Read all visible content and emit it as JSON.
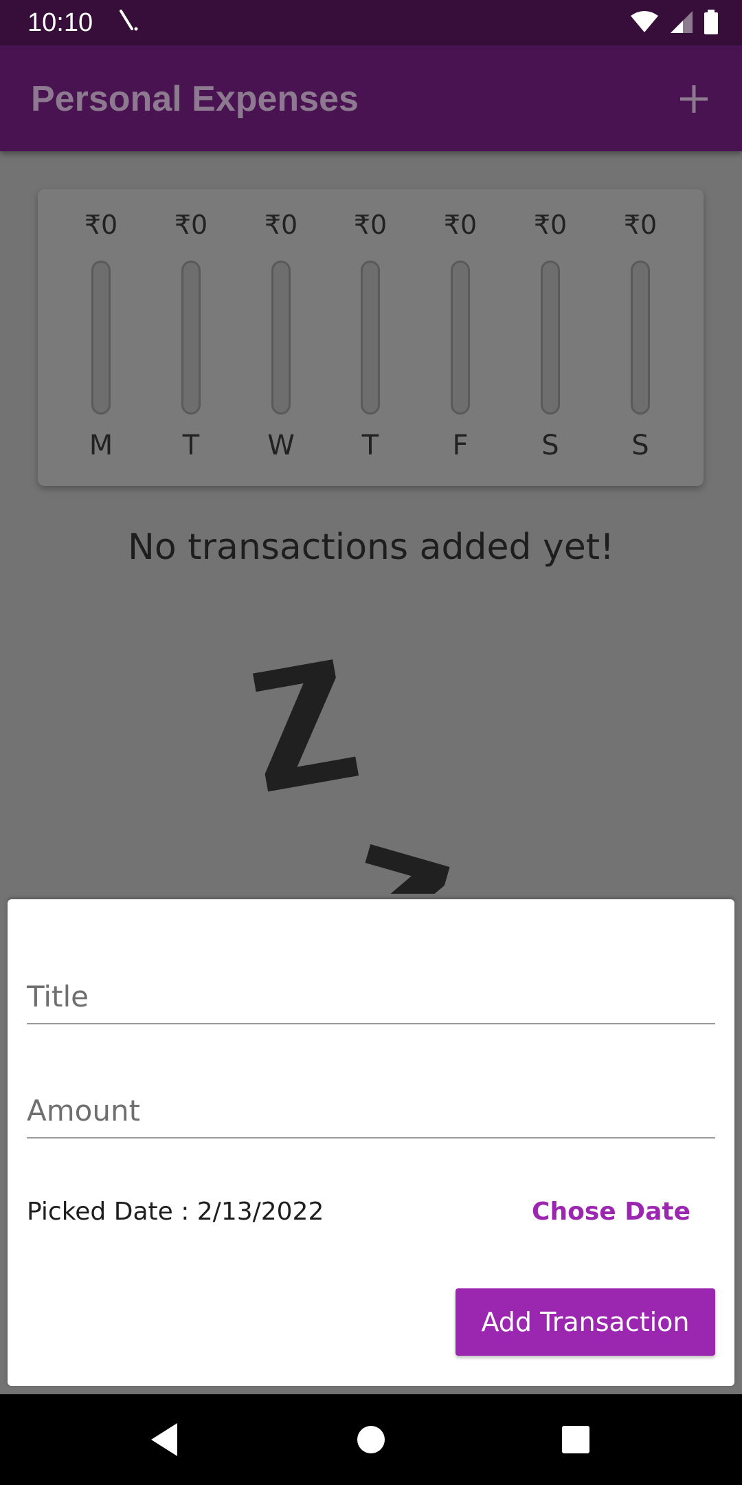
{
  "status_bar": {
    "time": "10:10",
    "icons": [
      "notification-icon",
      "wifi-icon",
      "signal-icon",
      "battery-icon"
    ],
    "background": "#360e39"
  },
  "app_bar": {
    "title": "Personal Expenses",
    "action_icon": "add-icon",
    "background": "#491251"
  },
  "chart": {
    "currency": "₹",
    "days": [
      {
        "label": "M",
        "amount": "₹0",
        "fraction": 0
      },
      {
        "label": "T",
        "amount": "₹0",
        "fraction": 0
      },
      {
        "label": "W",
        "amount": "₹0",
        "fraction": 0
      },
      {
        "label": "T",
        "amount": "₹0",
        "fraction": 0
      },
      {
        "label": "F",
        "amount": "₹0",
        "fraction": 0
      },
      {
        "label": "S",
        "amount": "₹0",
        "fraction": 0
      },
      {
        "label": "S",
        "amount": "₹0",
        "fraction": 0
      }
    ]
  },
  "empty_state": {
    "message": "No transactions added yet!",
    "image_icon": "sleeping-zzz-icon"
  },
  "form": {
    "title_placeholder": "Title",
    "title_value": "",
    "amount_placeholder": "Amount",
    "amount_value": "",
    "picked_date": "Picked Date : 2/13/2022",
    "chose_date_label": "Chose Date",
    "submit_label": "Add Transaction",
    "accent_color": "#9b27b0"
  },
  "nav_bar": {
    "icons": [
      "back-icon",
      "home-icon",
      "recents-icon"
    ]
  }
}
